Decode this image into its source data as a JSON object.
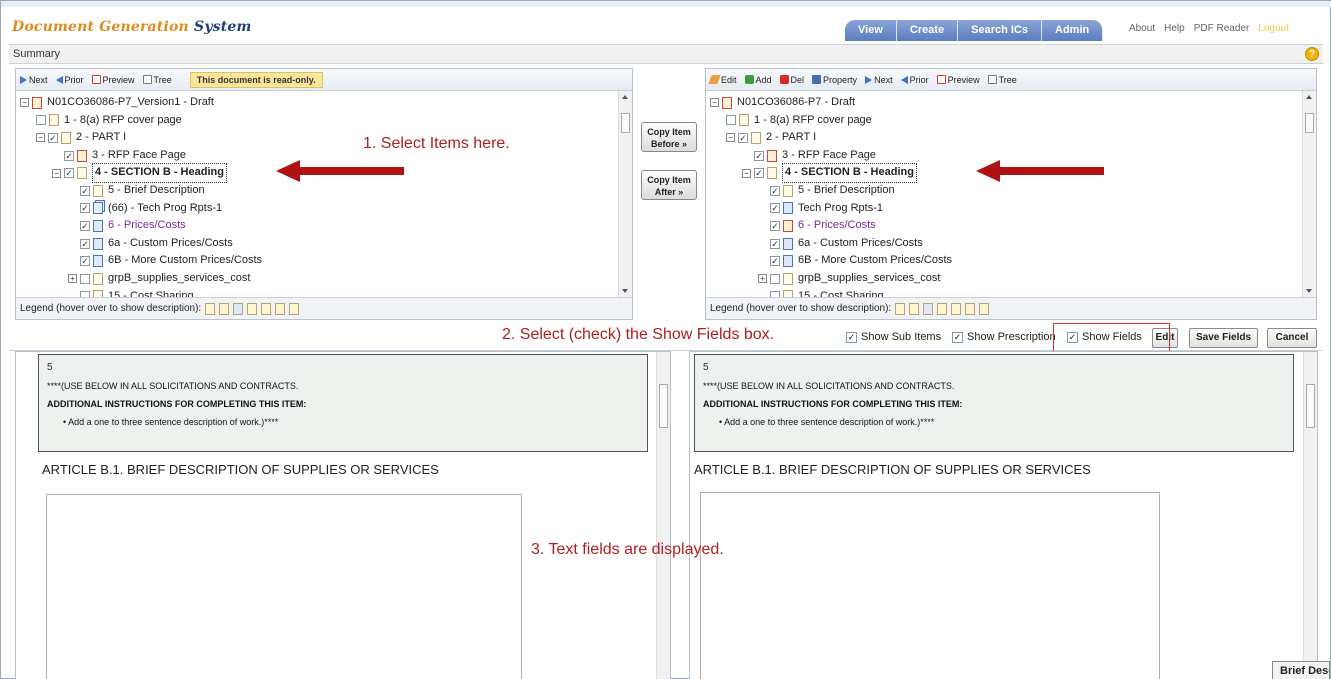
{
  "app": {
    "title_parts": [
      "Document ",
      "Generation ",
      "System"
    ]
  },
  "nav": {
    "tabs": [
      "View",
      "Create",
      "Search ICs",
      "Admin"
    ],
    "links": [
      "About",
      "Help",
      "PDF Reader"
    ],
    "logout": "Logout"
  },
  "summary": {
    "label": "Summary"
  },
  "left_panel": {
    "toolbar": [
      "Next",
      "Prior",
      "Preview",
      "Tree"
    ],
    "readonly_msg": "This document is read-only.",
    "tree": [
      {
        "label": "N01CO36086-P7_Version1 - Draft"
      },
      {
        "label": "1 - 8(a) RFP cover page"
      },
      {
        "label": "2 - PART I"
      },
      {
        "label": "3 - RFP Face Page"
      },
      {
        "label": "4 - SECTION B - Heading"
      },
      {
        "label": "5 - Brief Description"
      },
      {
        "label": "(66) - Tech Prog Rpts-1"
      },
      {
        "label": "6 - Prices/Costs"
      },
      {
        "label": "6a - Custom Prices/Costs"
      },
      {
        "label": "6B - More Custom Prices/Costs"
      },
      {
        "label": "grpB_supplies_services_cost"
      },
      {
        "label": "15 - Cost Sharing"
      }
    ],
    "legend": "Legend (hover over to show description):"
  },
  "right_panel": {
    "toolbar": [
      "Edit",
      "Add",
      "Del",
      "Property",
      "Next",
      "Prior",
      "Preview",
      "Tree"
    ],
    "tree": [
      {
        "label": "N01CO36086-P7 - Draft"
      },
      {
        "label": "1 - 8(a) RFP cover page"
      },
      {
        "label": "2 - PART I"
      },
      {
        "label": "3 - RFP Face Page"
      },
      {
        "label": "4 - SECTION B - Heading"
      },
      {
        "label": "5 - Brief Description"
      },
      {
        "label": "Tech Prog Rpts-1"
      },
      {
        "label": "6 - Prices/Costs"
      },
      {
        "label": "6a - Custom Prices/Costs"
      },
      {
        "label": "6B - More Custom Prices/Costs"
      },
      {
        "label": "grpB_supplies_services_cost"
      },
      {
        "label": "15 - Cost Sharing"
      }
    ],
    "legend": "Legend (hover over to show description):"
  },
  "copy_before": {
    "line1": "Copy Item",
    "line2": "Before »"
  },
  "copy_after": {
    "line1": "Copy Item",
    "line2": "After »"
  },
  "callouts": {
    "step1": "1. Select Items here.",
    "step2": "2. Select (check) the Show Fields box.",
    "step3": "3. Text fields are displayed."
  },
  "options": {
    "show_sub_items": "Show Sub Items",
    "show_prescription": "Show Prescription",
    "show_fields": "Show Fields",
    "edit": "Edit",
    "save_fields": "Save Fields",
    "cancel": "Cancel"
  },
  "content": {
    "note_num": "5",
    "note_line1": "****(USE BELOW IN ALL SOLICITATIONS AND CONTRACTS.",
    "note_line2": "ADDITIONAL INSTRUCTIONS FOR COMPLETING THIS ITEM:",
    "note_line3": "• Add a one to three sentence description of work.)****",
    "article": "ARTICLE B.1. BRIEF DESCRIPTION OF SUPPLIES OR SERVICES"
  },
  "tooltip": {
    "text": "Brief Description"
  },
  "colors": {
    "accent_red": "#b01e1e",
    "nav_blue": "#5b7cc0",
    "brand_orange": "#e08a1e",
    "brand_navy": "#1f3f7a"
  }
}
